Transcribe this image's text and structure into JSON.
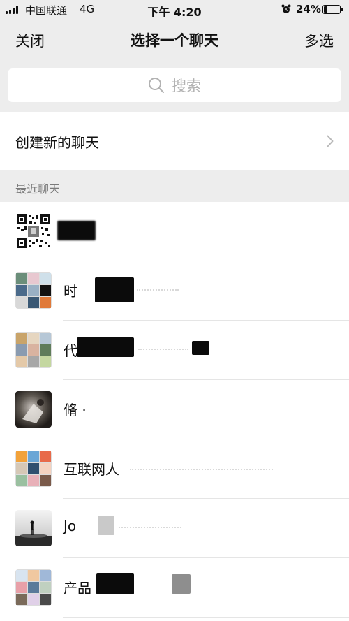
{
  "status_bar": {
    "carrier": "中国联通",
    "network": "4G",
    "time": "下午 4:20",
    "battery": "24%",
    "battery_level": 0.24,
    "icons": [
      "signal-icon",
      "alarm-icon",
      "battery-icon"
    ]
  },
  "nav": {
    "close_label": "关闭",
    "title": "选择一个聊天",
    "multi_select_label": "多选"
  },
  "search": {
    "placeholder": "搜索",
    "icon": "search-icon"
  },
  "create_chat": {
    "label": "创建新的聊天",
    "icon": "chevron-right-icon"
  },
  "recent": {
    "section_label": "最近聊天",
    "chats": [
      {
        "name": "",
        "avatar": "qr-code-avatar"
      },
      {
        "name": "时",
        "avatar": "group-grid-avatar"
      },
      {
        "name": "代市",
        "avatar": "group-grid-avatar"
      },
      {
        "name": "脩 ·",
        "avatar": "photo-avatar"
      },
      {
        "name": "互联网人",
        "avatar": "group-grid-avatar"
      },
      {
        "name": "Jo",
        "avatar": "silhouette-avatar"
      },
      {
        "name": "产品",
        "avatar": "group-grid-avatar"
      }
    ]
  },
  "colors": {
    "background": "#ededed",
    "surface": "#ffffff",
    "text_primary": "#111111",
    "text_secondary": "#7a7a7a",
    "placeholder": "#b2b2b2"
  }
}
